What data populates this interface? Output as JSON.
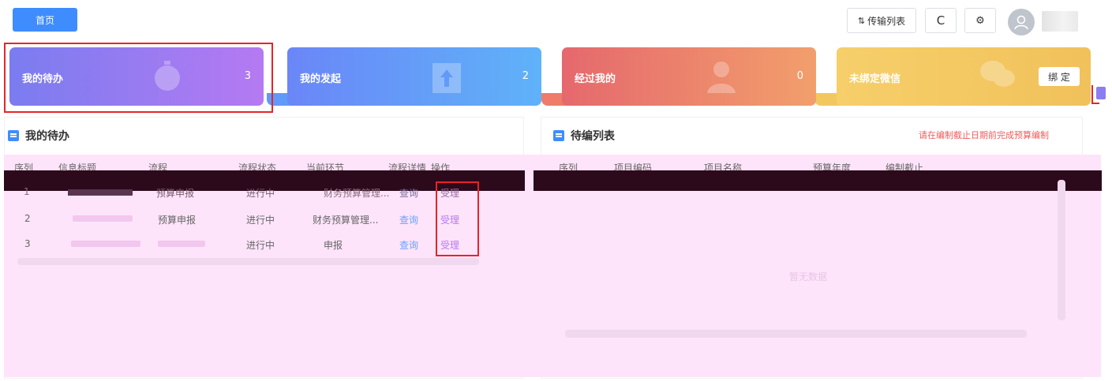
{
  "header": {
    "home_tab": "首页",
    "transfer_list_label": "传输列表",
    "refresh_icon": "refresh-icon",
    "settings_icon": "gear-icon"
  },
  "cards": [
    {
      "label": "我的待办",
      "count": "3",
      "color": "#9b7cf2"
    },
    {
      "label": "我的发起",
      "count": "2",
      "color": "#63a0f8"
    },
    {
      "label": "经过我的",
      "count": "0",
      "color": "#ec8370"
    },
    {
      "label": "未绑定微信",
      "bind_label": "绑 定",
      "color": "#f4c863"
    }
  ],
  "todo": {
    "title": "我的待办",
    "columns": [
      "序列",
      "信息标题",
      "流程",
      "流程状态",
      "当前环节",
      "流程详情",
      "操作"
    ],
    "rows": [
      {
        "seq": "1",
        "flow": "预算申报",
        "status": "进行中",
        "step": "财务预算管理...",
        "detail": "查询",
        "action": "受理"
      },
      {
        "seq": "2",
        "flow": "预算申报",
        "status": "进行中",
        "step": "财务预算管理...",
        "detail": "查询",
        "action": "受理"
      },
      {
        "seq": "3",
        "flow": "",
        "status": "进行中",
        "step": "申报",
        "detail": "查询",
        "action": "受理"
      }
    ]
  },
  "pending": {
    "title": "待编列表",
    "notice": "请在编制截止日期前完成预算编制",
    "columns": [
      "序列",
      "项目编码",
      "项目名称",
      "预算年度",
      "编制截止"
    ],
    "empty_text": "暂无数据"
  }
}
